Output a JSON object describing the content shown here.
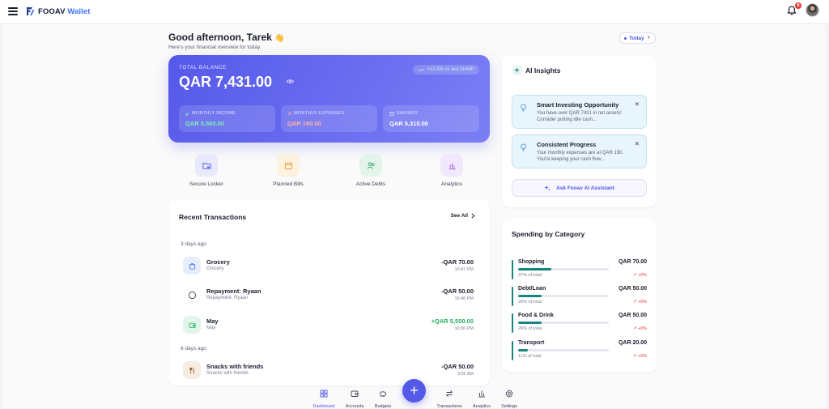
{
  "brand": {
    "name1": "FOOAV",
    "name2": "Wallet"
  },
  "header": {
    "notification_count": "8"
  },
  "greeting": {
    "title": "Good afternoon, Tarek",
    "emoji": "👋",
    "subtitle": "Here's your financial overview for today."
  },
  "period": {
    "label": "Today"
  },
  "balance": {
    "label": "TOTAL BALANCE",
    "amount": "QAR 7,431.00",
    "trend": "+12.5% vs last month",
    "stats": [
      {
        "label": "MONTHLY INCOME",
        "value": "QAR 5,500.00",
        "color": "#7ff0b6"
      },
      {
        "label": "MONTHLY EXPENSES",
        "value": "QAR 190.00",
        "color": "#ffb3a6"
      },
      {
        "label": "SAVINGS",
        "value": "QAR 5,310.00",
        "color": "#ffffff"
      }
    ]
  },
  "quick_actions": [
    {
      "label": "Secure Locker",
      "icon": "folder-lock-icon"
    },
    {
      "label": "Planned Bills",
      "icon": "calendar-icon"
    },
    {
      "label": "Active Debts",
      "icon": "users-icon"
    },
    {
      "label": "Analytics",
      "icon": "bar-chart-icon"
    }
  ],
  "transactions": {
    "title": "Recent Transactions",
    "see_all": "See All",
    "groups": [
      {
        "day": "3 days ago",
        "items": [
          {
            "name": "Grocery",
            "sub": "Grocery",
            "amount": "-QAR 70.00",
            "time": "10:47 PM",
            "icon": "shopping-bag-icon"
          },
          {
            "name": "Repayment: Ryaan",
            "sub": "Repayment: Ryaan",
            "amount": "-QAR 50.00",
            "time": "10:46 PM",
            "icon": "circle-icon"
          },
          {
            "name": "May",
            "sub": "May",
            "amount": "+QAR 5,500.00",
            "time": "10:36 PM",
            "icon": "wallet-icon"
          }
        ]
      },
      {
        "day": "6 days ago",
        "items": [
          {
            "name": "Snacks with friends",
            "sub": "Snacks with friends",
            "amount": "-QAR 50.00",
            "time": "3:00 AM",
            "icon": "utensils-icon"
          }
        ]
      }
    ]
  },
  "ai": {
    "title": "AI Insights",
    "insights": [
      {
        "title": "Smart Investing Opportunity",
        "desc": "You have over QAR 7431 in net assets! Consider putting idle cash..."
      },
      {
        "title": "Consistent Progress",
        "desc": "Your monthly expenses are at QAR 190. You're keeping your cash flow..."
      }
    ],
    "ask_label": "Ask Fooav AI Assistant"
  },
  "spending": {
    "title": "Spending by Category",
    "items": [
      {
        "name": "Shopping",
        "amount": "QAR 70.00",
        "pct_label": "37% of total",
        "pct": 37,
        "change": "+0%"
      },
      {
        "name": "Debt/Loan",
        "amount": "QAR 50.00",
        "pct_label": "26% of total",
        "pct": 26,
        "change": "+0%"
      },
      {
        "name": "Food & Drink",
        "amount": "QAR 50.00",
        "pct_label": "26% of total",
        "pct": 26,
        "change": "+0%"
      },
      {
        "name": "Transport",
        "amount": "QAR 20.00",
        "pct_label": "11% of total",
        "pct": 11,
        "change": "+0%"
      }
    ]
  },
  "nav": {
    "items": [
      {
        "label": "Dashboard",
        "active": true
      },
      {
        "label": "Accounts"
      },
      {
        "label": "Budgets"
      },
      {
        "label": "Transactions"
      },
      {
        "label": "Analytics"
      },
      {
        "label": "Settings"
      }
    ],
    "fab": "+"
  },
  "colors": {
    "accent": "#5559e8",
    "positive": "#22b05e",
    "negative": "#e53935",
    "teal": "#17857e"
  }
}
